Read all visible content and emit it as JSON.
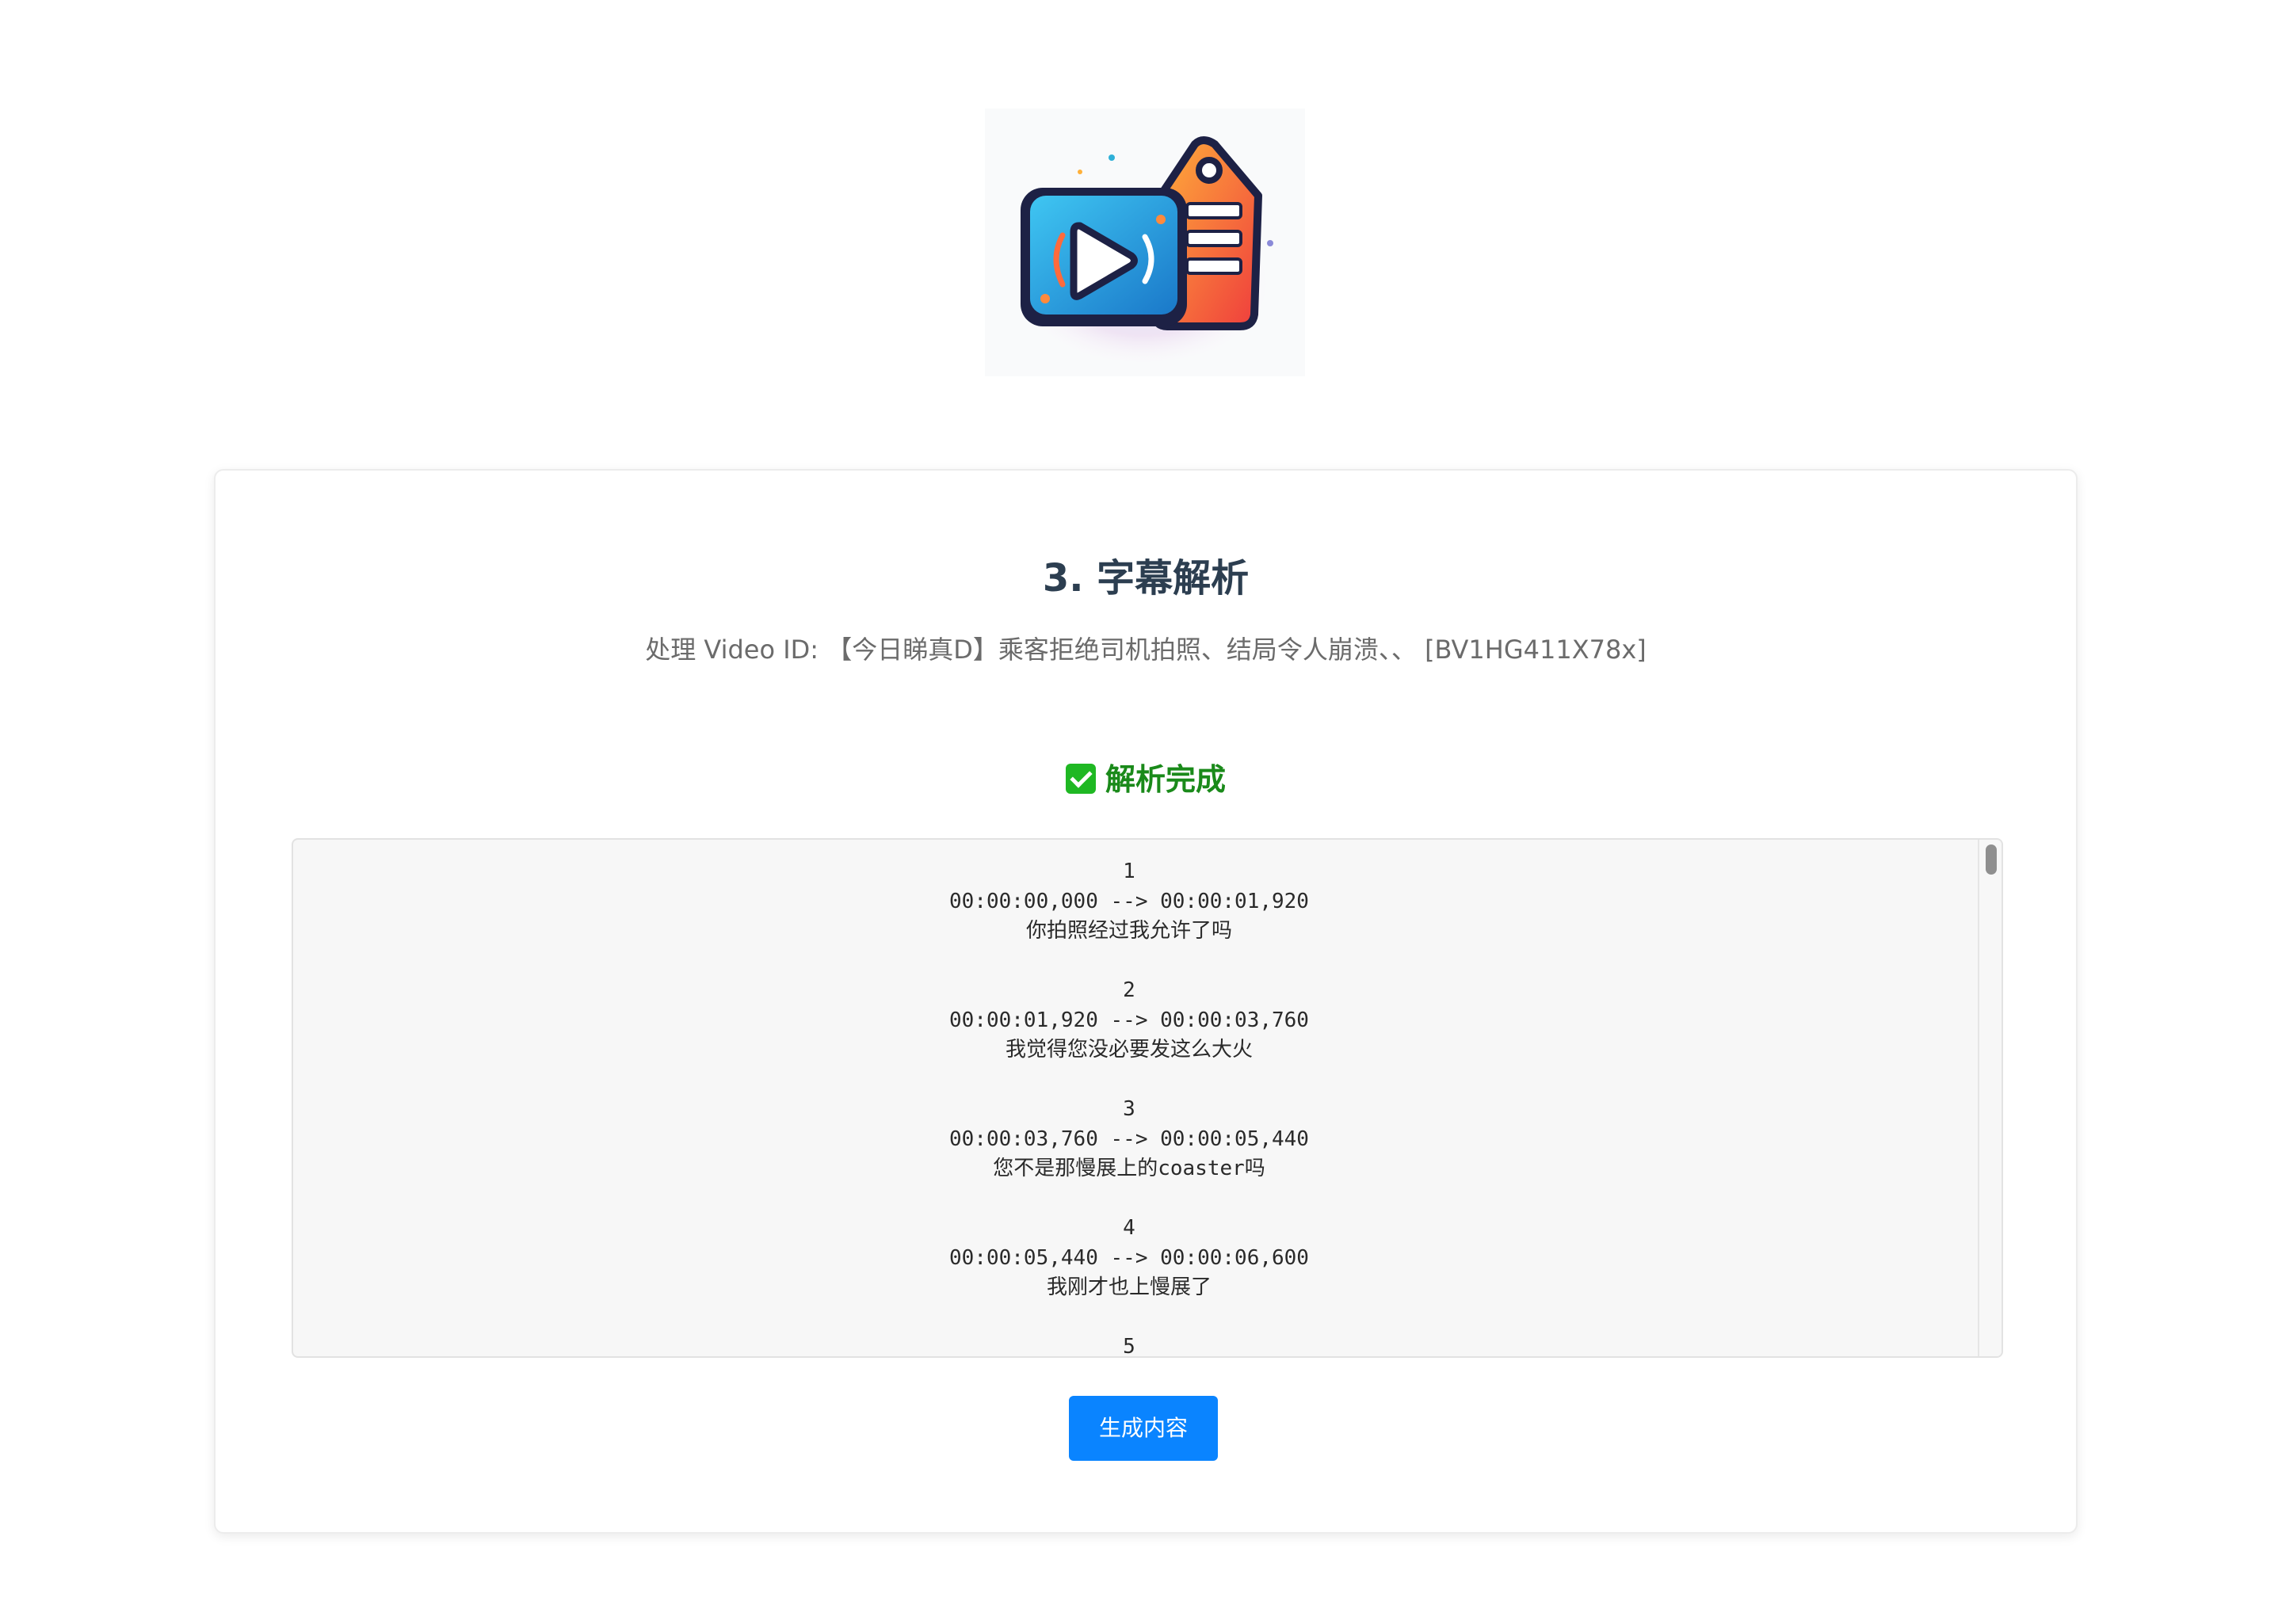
{
  "header": {
    "logo_icon": "video-subtitle-tag-logo-icon"
  },
  "card": {
    "title": "3. 字幕解析",
    "subtitle": "处理 Video ID: 【今日睇真D】乘客拒绝司机拍照、结局令人崩溃、、 [BV1HG411X78x]",
    "status": {
      "icon": "check-mark-icon",
      "text": "解析完成",
      "color": "#1a8a1a"
    },
    "subtitles": [
      {
        "index": "1",
        "time": "00:00:00,000 --> 00:00:01,920",
        "text": "你拍照经过我允许了吗"
      },
      {
        "index": "2",
        "time": "00:00:01,920 --> 00:00:03,760",
        "text": "我觉得您没必要发这么大火"
      },
      {
        "index": "3",
        "time": "00:00:03,760 --> 00:00:05,440",
        "text": "您不是那慢展上的coaster吗"
      },
      {
        "index": "4",
        "time": "00:00:05,440 --> 00:00:06,600",
        "text": "我刚才也上慢展了"
      },
      {
        "index": "5"
      }
    ],
    "generate_button": "生成内容",
    "accent_color": "#0a84ff"
  }
}
